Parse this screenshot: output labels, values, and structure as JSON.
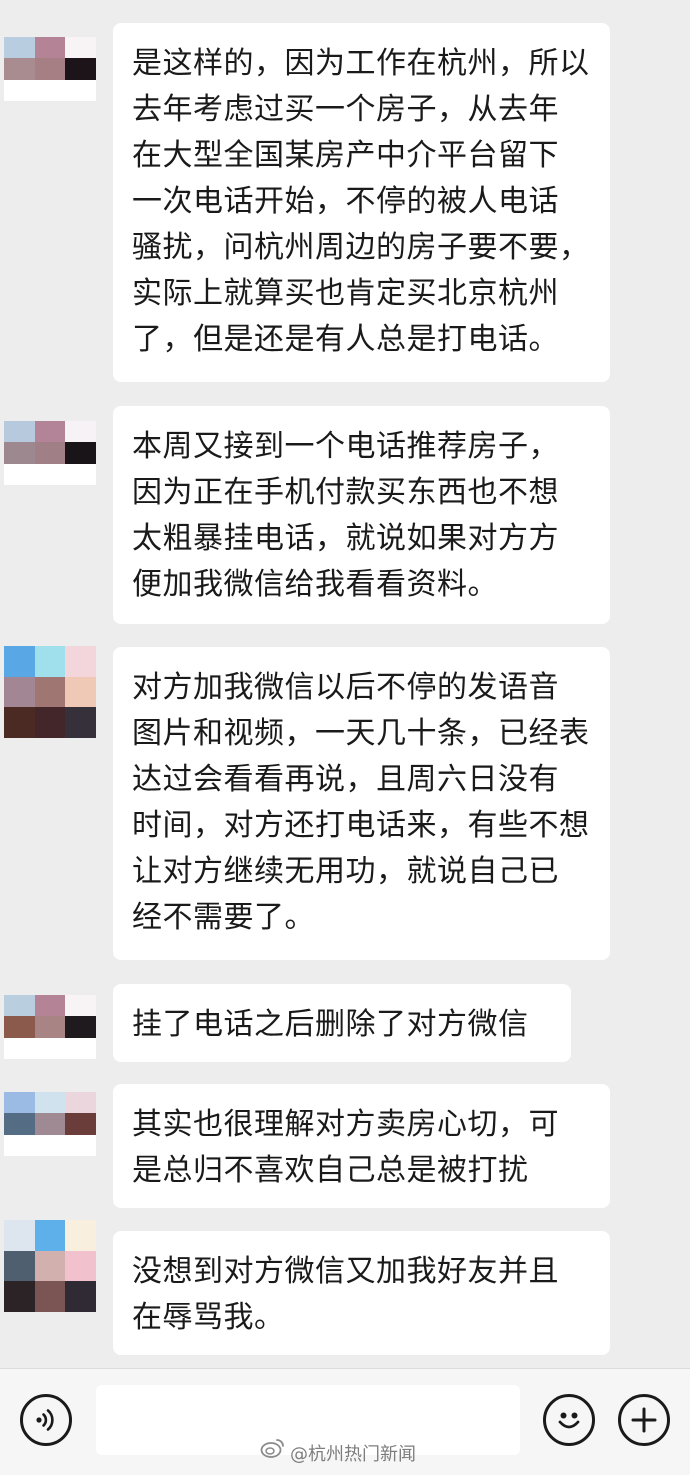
{
  "messages": [
    {
      "text": "是这样的，因为工作在杭州，所以\n去年考虑过买一个房子，从去年\n在大型全国某房产中介平台留下\n一次电话开始，不停的被人电话\n骚扰，问杭州周边的房子要不要，\n实际上就算买也肯定买北京杭州\n了，但是还是有人总是打电话。"
    },
    {
      "text": "本周又接到一个电话推荐房子，\n因为正在手机付款买东西也不想\n太粗暴挂电话，就说如果对方方\n便加我微信给我看看资料。"
    },
    {
      "text": "对方加我微信以后不停的发语音\n图片和视频，一天几十条，已经表\n达过会看看再说，且周六日没有\n时间，对方还打电话来，有些不想\n让对方继续无用功，就说自己已\n经不需要了。"
    },
    {
      "text": "挂了电话之后删除了对方微信"
    },
    {
      "text": "其实也很理解对方卖房心切，可\n是总归不喜欢自己总是被打扰"
    },
    {
      "text": "没想到对方微信又加我好友并且\n在辱骂我。"
    }
  ],
  "avatars": [
    [
      "#b9cde0",
      "#b48496",
      "#f8f4f6",
      "#a98c8f",
      "#a67f85",
      "#1c1418",
      "#ffffff",
      "#ffffff",
      "#ffffff"
    ],
    [
      "#b7cadd",
      "#b38497",
      "#f7f2f5",
      "#9d8890",
      "#a07f86",
      "#191418",
      "#ffffff",
      "#ffffff",
      "#ffffff"
    ],
    [
      "#5aa7e6",
      "#9fe0ec",
      "#f3d6db",
      "#a28693",
      "#a07673",
      "#f0c9b6",
      "#4c2a24",
      "#43262a",
      "#35303a"
    ],
    [
      "#b9cfe0",
      "#b48496",
      "#f8f4f6",
      "#8c5a4c",
      "#a98485",
      "#1f1a1d",
      "#ffffff",
      "#ffffff",
      "#ffffff"
    ],
    [
      "#9bbbe4",
      "#cfe2ee",
      "#ecd6de",
      "#556c85",
      "#9f8a93",
      "#6a3c3a",
      "#ffffff",
      "#ffffff",
      "#ffffff"
    ],
    [
      "#dde6ef",
      "#5eb0ea",
      "#f8efdf",
      "#4f5f70",
      "#d2b0ad",
      "#f1c1cd",
      "#2b2326",
      "#7b5553",
      "#2f2a33"
    ]
  ],
  "input_bar": {
    "voice_icon": "voice-icon",
    "emoji_icon": "emoji-icon",
    "plus_icon": "plus-icon"
  },
  "watermark": {
    "text": "@杭州热门新闻"
  }
}
